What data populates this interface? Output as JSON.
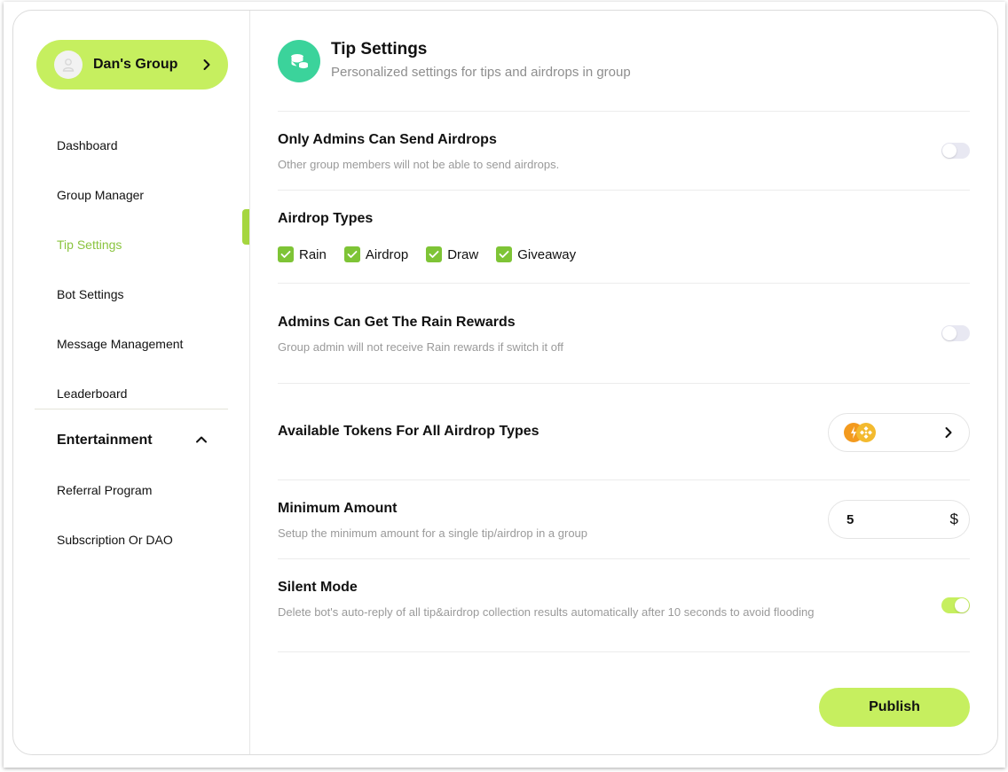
{
  "sidebar": {
    "group_name": "Dan's Group",
    "items": [
      {
        "label": "Dashboard"
      },
      {
        "label": "Group Manager"
      },
      {
        "label": "Tip Settings"
      },
      {
        "label": "Bot Settings"
      },
      {
        "label": "Message Management"
      },
      {
        "label": "Leaderboard"
      }
    ],
    "section": {
      "title": "Entertainment",
      "expanded": true,
      "items": [
        {
          "label": "Referral Program"
        },
        {
          "label": "Subscription Or DAO"
        }
      ]
    },
    "active_item": "Tip Settings"
  },
  "header": {
    "title": "Tip Settings",
    "subtitle": "Personalized settings for tips and airdrops in group",
    "icon": "coins-icon"
  },
  "settings": {
    "admins_only": {
      "title": "Only Admins Can Send Airdrops",
      "desc": "Other group members will not be able to send airdrops.",
      "enabled": false
    },
    "airdrop_types": {
      "title": "Airdrop Types",
      "options": [
        {
          "label": "Rain",
          "checked": true
        },
        {
          "label": "Airdrop",
          "checked": true
        },
        {
          "label": "Draw",
          "checked": true
        },
        {
          "label": "Giveaway",
          "checked": true
        }
      ]
    },
    "admin_rain": {
      "title": "Admins Can Get The Rain Rewards",
      "desc": "Group admin will not receive Rain rewards if switch it off",
      "enabled": false
    },
    "tokens": {
      "title": "Available Tokens For All Airdrop Types",
      "token_icons": [
        "orange-token-icon",
        "bnb-token-icon"
      ]
    },
    "minimum": {
      "title": "Minimum Amount",
      "desc": "Setup the minimum amount for a single tip/airdrop in a group",
      "value": "5",
      "unit": "$"
    },
    "silent": {
      "title": "Silent Mode",
      "desc": "Delete bot's auto-reply of all tip&airdrop collection results automatically after 10 seconds to avoid flooding",
      "enabled": true
    }
  },
  "publish_label": "Publish",
  "colors": {
    "accent": "#c6ef5f",
    "active_text": "#8ac43f",
    "check": "#7ec436",
    "header_icon_bg": "#3bd39b"
  }
}
